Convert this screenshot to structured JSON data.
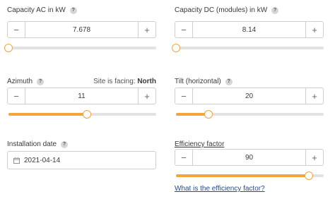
{
  "capacity_ac": {
    "label": "Capacity AC in kW",
    "value": "7.678",
    "minus": "−",
    "plus": "+",
    "help": "?",
    "slider_fraction": 0.0
  },
  "capacity_dc": {
    "label": "Capacity DC (modules) in kW",
    "value": "8.14",
    "minus": "−",
    "plus": "+",
    "help": "?",
    "slider_fraction": 0.0
  },
  "azimuth": {
    "label": "Azimuth",
    "value": "11",
    "minus": "−",
    "plus": "+",
    "help": "?",
    "facing_prefix": "Site is facing:",
    "facing_value": "North",
    "slider_fraction": 0.53
  },
  "tilt": {
    "label": "Tilt (horizontal)",
    "value": "20",
    "minus": "−",
    "plus": "+",
    "help": "?",
    "slider_fraction": 0.22
  },
  "installation_date": {
    "label": "Installation date",
    "value": "2021-04-14",
    "help": "?"
  },
  "efficiency": {
    "label": "Efficiency factor",
    "value": "90",
    "minus": "−",
    "plus": "+",
    "slider_fraction": 0.9,
    "link": "What is the efficiency factor?"
  },
  "colors": {
    "accent": "#f4a43b",
    "track": "#e2e2e2",
    "border": "#cfcfcf",
    "link": "#2a4a8a"
  }
}
